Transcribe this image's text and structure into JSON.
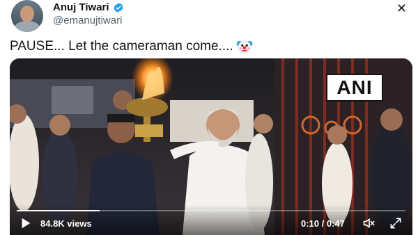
{
  "tweet": {
    "author_name": "Anuj Tiwari",
    "author_handle": "@emanujtiwari",
    "text": "PAUSE... Let the cameraman come....",
    "emoji_icon": "clown-face-icon"
  },
  "header": {
    "close_symbol": "✕"
  },
  "video": {
    "watermark": "ANI",
    "views_label": "84.8K views",
    "time_label": "0:10 / 0:47",
    "progress_fraction": 0.213,
    "icons": [
      "play-icon",
      "volume-icon",
      "expand-icon"
    ]
  },
  "colors": {
    "verified": "#1d9bf0",
    "handle": "#536471",
    "text": "#0f1419"
  }
}
